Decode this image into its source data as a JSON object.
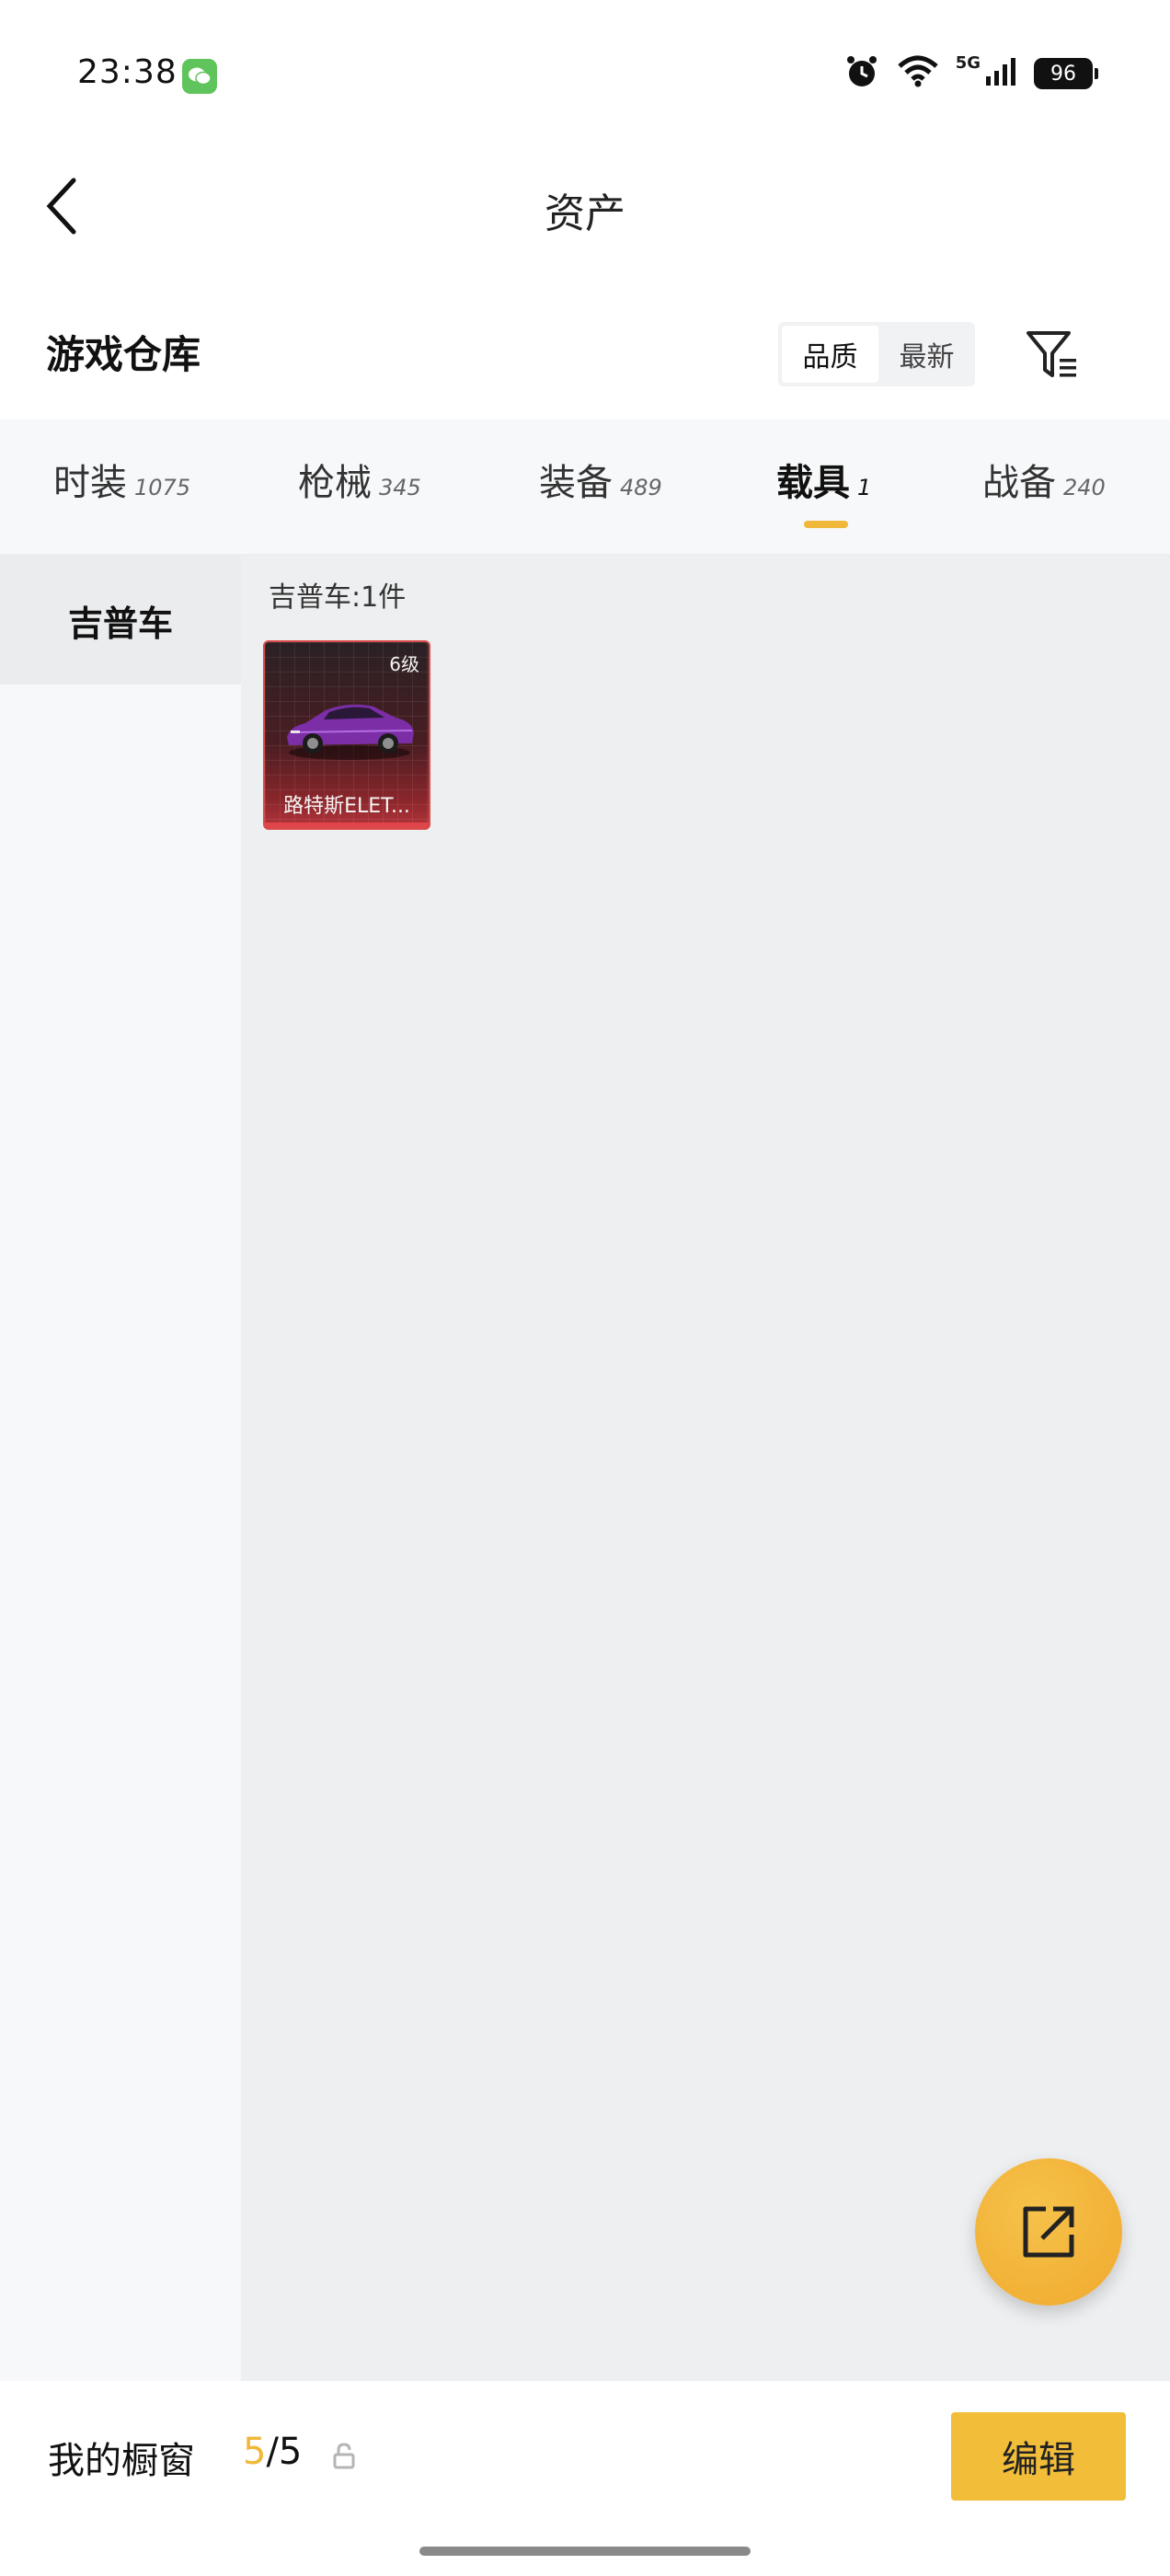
{
  "status_bar": {
    "time": "23:38",
    "network": "5G",
    "battery": "96",
    "icons": [
      "wechat-icon",
      "alarm-icon",
      "wifi-icon",
      "signal-icon",
      "battery-icon"
    ]
  },
  "header": {
    "title": "资产",
    "back_icon": "chevron-left-icon"
  },
  "warehouse": {
    "title": "游戏仓库",
    "sort_options": [
      "品质",
      "最新"
    ],
    "active_sort": "品质",
    "filter_icon": "filter-icon"
  },
  "tabs": [
    {
      "label": "时装",
      "count": "1075"
    },
    {
      "label": "枪械",
      "count": "345"
    },
    {
      "label": "装备",
      "count": "489"
    },
    {
      "label": "载具",
      "count": "1"
    },
    {
      "label": "战备",
      "count": "240"
    }
  ],
  "active_tab": "载具",
  "sidebar": {
    "items": [
      {
        "label": "吉普车"
      }
    ]
  },
  "content": {
    "group_title": "吉普车:1件",
    "items": [
      {
        "name": "路特斯ELET...",
        "level": "6级",
        "image": "purple-car"
      }
    ]
  },
  "fab": {
    "icon": "share-icon"
  },
  "bottom_bar": {
    "showcase_label": "我的橱窗",
    "showcase_current": "5",
    "showcase_sep": "/5",
    "lock_icon": "lock-icon",
    "edit_label": "编辑"
  },
  "colors": {
    "accent": "#f0b83a",
    "item_border": "#d94a4a",
    "car": "#7b2ea6"
  }
}
